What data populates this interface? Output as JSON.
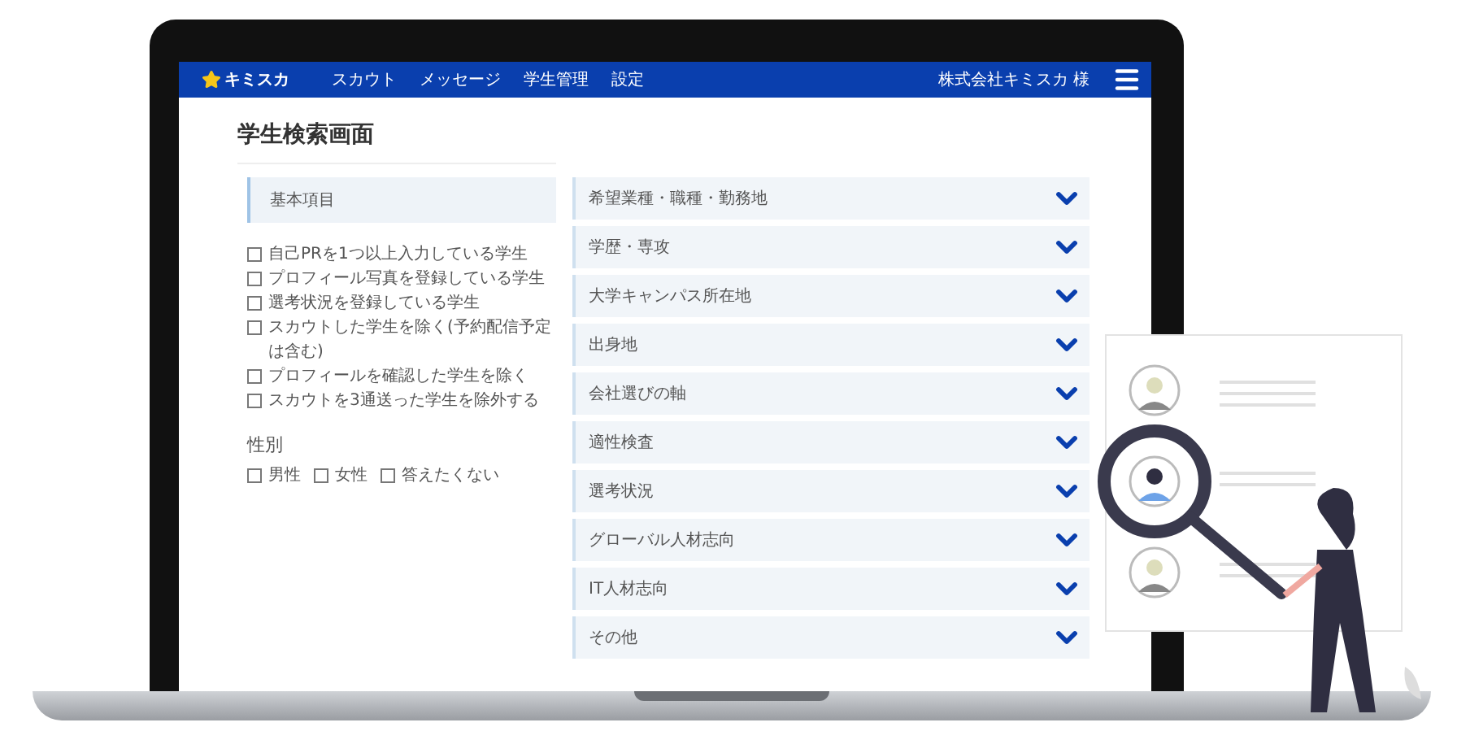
{
  "nav": {
    "logo": "キミスカ",
    "items": [
      "スカウト",
      "メッセージ",
      "学生管理",
      "設定"
    ],
    "account": "株式会社キミスカ 様"
  },
  "page_title": "学生検索画面",
  "basic": {
    "heading": "基本項目",
    "options": [
      {
        "label": "自己PRを1つ以上入力している学生",
        "checked": false
      },
      {
        "label": "プロフィール写真を登録している学生",
        "checked": false
      },
      {
        "label": "選考状況を登録している学生",
        "checked": false
      },
      {
        "label": "スカウトした学生を除く(予約配信予定は含む)",
        "checked": false
      },
      {
        "label": "プロフィールを確認した学生を除く",
        "checked": false
      },
      {
        "label": "スカウトを3通送った学生を除外する",
        "checked": false
      }
    ]
  },
  "gender": {
    "heading": "性別",
    "options": [
      {
        "label": "男性",
        "checked": false
      },
      {
        "label": "女性",
        "checked": false
      },
      {
        "label": "答えたくない",
        "checked": false
      }
    ]
  },
  "sections": [
    {
      "label": "希望業種・職種・勤務地",
      "expanded": false
    },
    {
      "label": "学歴・専攻",
      "expanded": false
    },
    {
      "label": "大学キャンパス所在地",
      "expanded": false
    },
    {
      "label": "出身地",
      "expanded": false
    },
    {
      "label": "会社選びの軸",
      "expanded": false
    },
    {
      "label": "適性検査",
      "expanded": false
    },
    {
      "label": "選考状況",
      "expanded": false
    },
    {
      "label": "グローバル人材志向",
      "expanded": false
    },
    {
      "label": "IT人材志向",
      "expanded": false
    },
    {
      "label": "その他",
      "expanded": false
    }
  ]
}
